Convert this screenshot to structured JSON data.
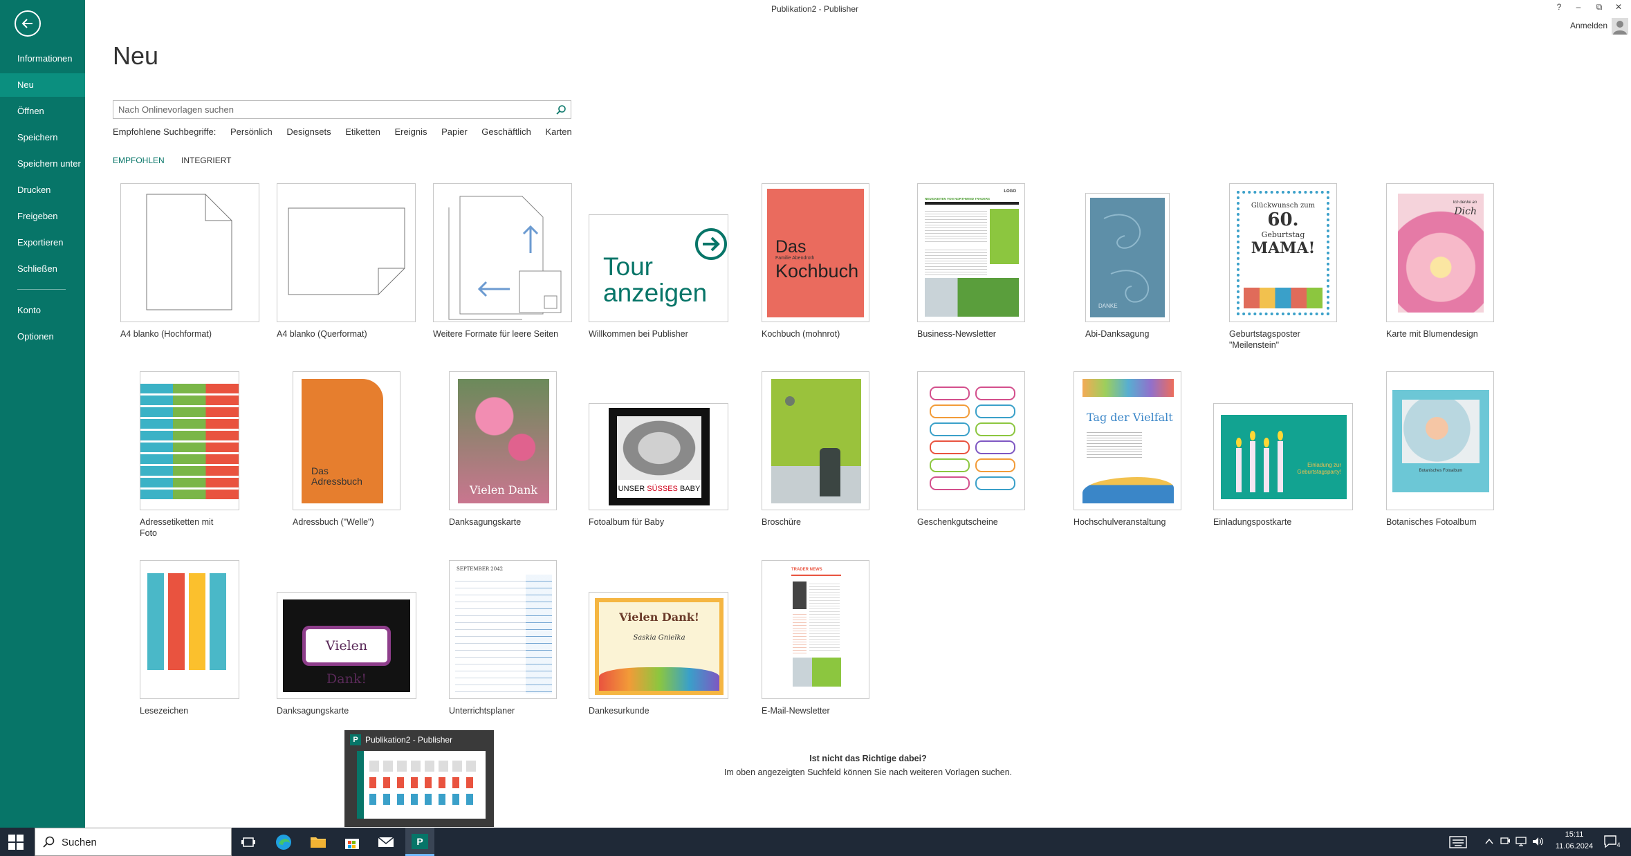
{
  "window": {
    "title": "Publikation2 - Publisher",
    "help": "?",
    "minimize": "–",
    "restore": "⧉",
    "close": "✕",
    "sign_in": "Anmelden"
  },
  "sidebar": {
    "items": [
      {
        "label": "Informationen"
      },
      {
        "label": "Neu"
      },
      {
        "label": "Öffnen"
      },
      {
        "label": "Speichern"
      },
      {
        "label": "Speichern unter"
      },
      {
        "label": "Drucken"
      },
      {
        "label": "Freigeben"
      },
      {
        "label": "Exportieren"
      },
      {
        "label": "Schließen"
      },
      {
        "label": "Konto"
      },
      {
        "label": "Optionen"
      }
    ]
  },
  "main": {
    "title": "Neu",
    "search_placeholder": "Nach Onlinevorlagen suchen",
    "suggestions": [
      "Empfohlene Suchbegriffe:",
      "Persönlich",
      "Designsets",
      "Etiketten",
      "Ereignis",
      "Papier",
      "Geschäftlich",
      "Karten"
    ],
    "tabs": [
      {
        "label": "EMPFOHLEN"
      },
      {
        "label": "INTEGRIERT"
      }
    ],
    "templates": [
      {
        "label": "A4 blanko (Hochformat)"
      },
      {
        "label": "A4 blanko (Querformat)"
      },
      {
        "label": "Weitere Formate für leere Seiten"
      },
      {
        "label": "Willkommen bei Publisher",
        "text": [
          "Tour",
          "anzeigen"
        ]
      },
      {
        "label": "Kochbuch (mohnrot)",
        "text": [
          "Das",
          "Kochbuch",
          "Familie Abendroth"
        ]
      },
      {
        "label": "Business-Newsletter",
        "text": [
          "NEUIGKEITEN VON NORTHWIND TRADERS",
          "LOGO"
        ]
      },
      {
        "label": "Abi-Danksagung",
        "text": [
          "DANKE"
        ]
      },
      {
        "label": "Geburtstagsposter \"Meilenstein\"",
        "text": [
          "Glückwunsch zum",
          "60.",
          "Geburtstag",
          "MAMA!"
        ]
      },
      {
        "label": "Karte mit Blumendesign",
        "text": [
          "Ich denke an",
          "Dich"
        ]
      },
      {
        "label": "Adressetiketten mit Foto"
      },
      {
        "label": "Adressbuch (\"Welle\")",
        "text": [
          "Das",
          "Adressbuch"
        ]
      },
      {
        "label": "Danksagungskarte",
        "text": [
          "Vielen Dank"
        ]
      },
      {
        "label": "Fotoalbum für Baby",
        "text": [
          "UNSER",
          "SÜSSES",
          "BABY"
        ]
      },
      {
        "label": "Broschüre"
      },
      {
        "label": "Geschenkgutscheine"
      },
      {
        "label": "Hochschulveranstaltung",
        "text": [
          "Tag der Vielfalt"
        ]
      },
      {
        "label": "Einladungspostkarte",
        "text": [
          "Einladung zur",
          "Geburtstagsparty!"
        ]
      },
      {
        "label": "Botanisches Fotoalbum",
        "text": [
          "Botanisches Fotoalbum"
        ]
      },
      {
        "label": "Lesezeichen"
      },
      {
        "label": "Danksagungskarte",
        "text": [
          "Vielen Dank!"
        ]
      },
      {
        "label": "Unterrichtsplaner",
        "text": [
          "SEPTEMBER 2042"
        ]
      },
      {
        "label": "Dankesurkunde",
        "text": [
          "Vielen Dank!",
          "Saskia Gnielka"
        ]
      },
      {
        "label": "E-Mail-Newsletter",
        "text": [
          "TRADER NEWS"
        ]
      }
    ],
    "help_question": "Ist nicht das Richtige dabei?",
    "help_text": "Im oben angezeigten Suchfeld können Sie nach weiteren Vorlagen suchen."
  },
  "taskbar": {
    "search_label": "Suchen",
    "preview_title": "Publikation2 - Publisher",
    "time": "15:11",
    "date": "11.06.2024",
    "notifications": "4"
  },
  "colors": {
    "accent": "#077568",
    "sidebar": "#077568"
  }
}
